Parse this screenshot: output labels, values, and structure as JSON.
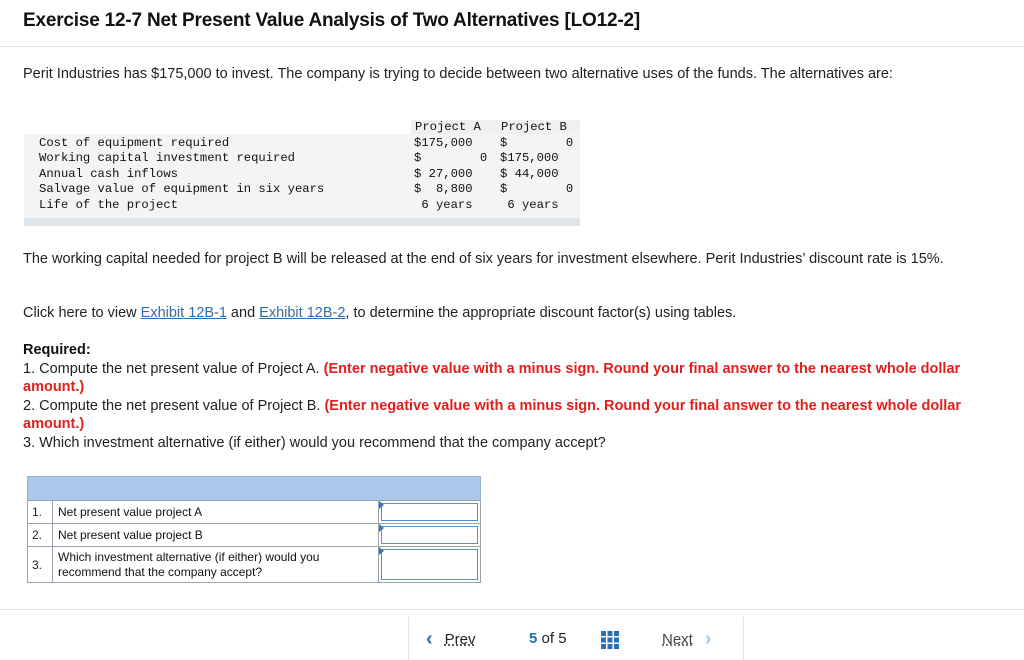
{
  "title": "Exercise 12-7 Net Present Value Analysis of Two Alternatives [LO12-2]",
  "intro": "Perit Industries has $175,000 to invest. The company is trying to decide between two alternative uses of the funds. The alternatives are:",
  "data_table": {
    "headers": [
      "Project A",
      "Project B"
    ],
    "rows": [
      {
        "label": "Cost of equipment required",
        "a": "$175,000",
        "b": "$        0"
      },
      {
        "label": "Working capital investment required",
        "a": "$        0",
        "b": "$175,000"
      },
      {
        "label": "Annual cash inflows",
        "a": "$ 27,000",
        "b": "$ 44,000"
      },
      {
        "label": "Salvage value of equipment in six years",
        "a": "$  8,800",
        "b": "$        0"
      },
      {
        "label": "Life of the project",
        "a": " 6 years",
        "b": " 6 years"
      }
    ]
  },
  "working_capital_text": "The working capital needed for project B will be released at the end of six years for investment elsewhere. Perit Industries’ discount rate is 15%.",
  "click_line": {
    "prefix": "Click here to view ",
    "link1": "Exhibit 12B-1",
    "middle": " and ",
    "link2": "Exhibit 12B-2",
    "suffix": ", to determine the appropriate discount factor(s) using tables."
  },
  "required": {
    "title": "Required:",
    "items": [
      {
        "text": "1. Compute the net present value of Project A. ",
        "note": "(Enter negative value with a minus sign. Round your final answer to the nearest whole dollar amount.)"
      },
      {
        "text": "2. Compute the net present value of Project B. ",
        "note": "(Enter negative value with a minus sign. Round your final answer to the nearest whole dollar amount.)"
      },
      {
        "text": "3. Which investment alternative (if either) would you recommend that the company accept?",
        "note": ""
      }
    ]
  },
  "answer_table": {
    "rows": [
      {
        "num": "1.",
        "label": "Net present value project A",
        "value": ""
      },
      {
        "num": "2.",
        "label": "Net present value project B",
        "value": ""
      },
      {
        "num": "3.",
        "label": "Which investment alternative (if either) would you recommend that the company accept?",
        "value": ""
      }
    ]
  },
  "footer": {
    "prev_label": "Prev",
    "page_current": "5",
    "page_of": "of 5",
    "next_label": "Next",
    "grid_icon": "grid-icon"
  },
  "colors": {
    "link": "#2a6fb0",
    "red_note": "#e0201d",
    "answer_header": "#a9c8ea"
  }
}
